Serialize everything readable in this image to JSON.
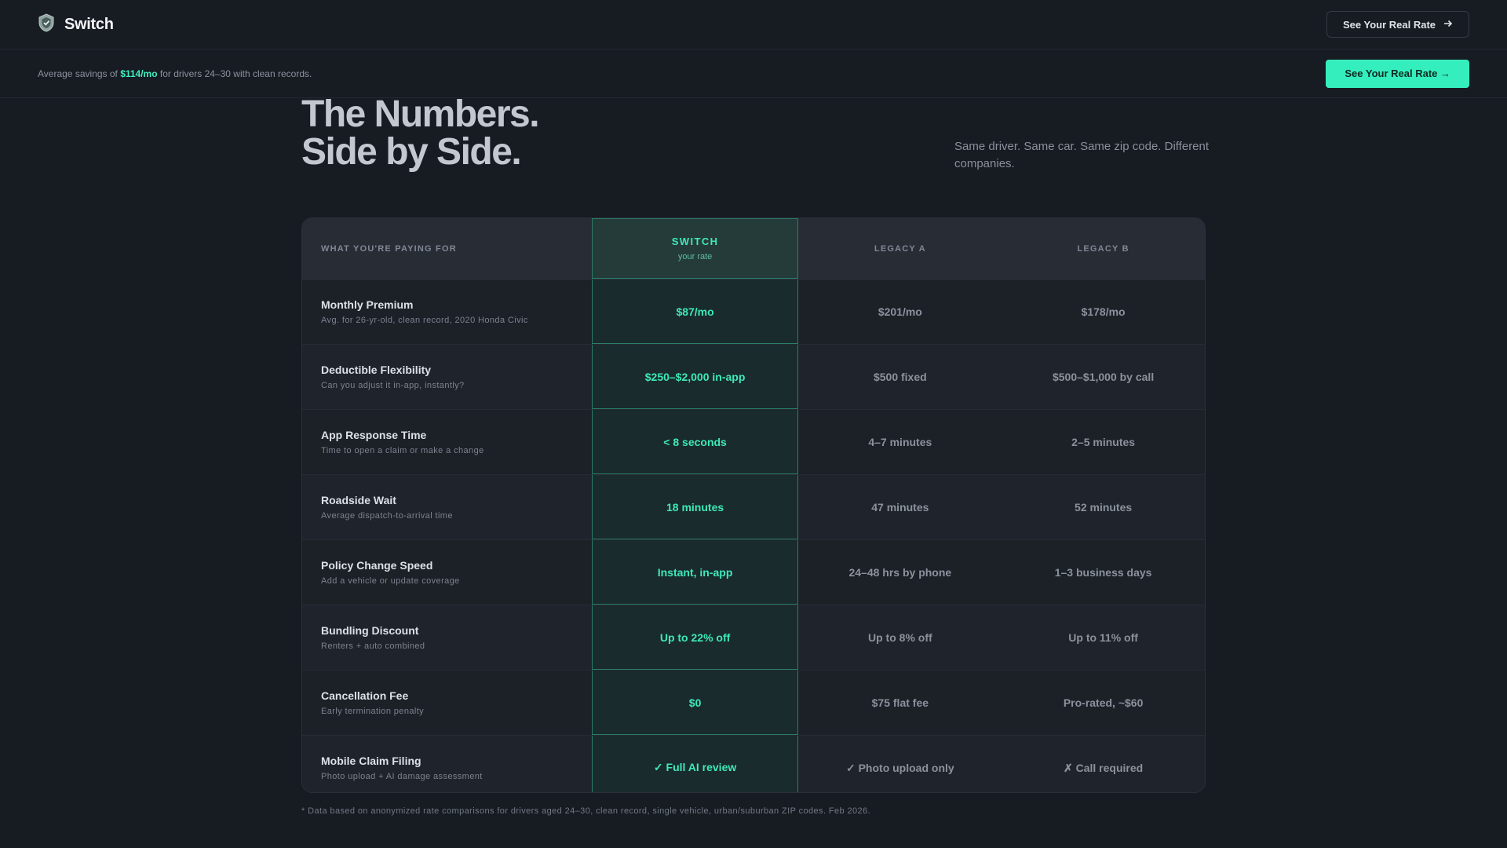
{
  "nav": {
    "brand": "Switch",
    "cta_label": "See Your Real Rate",
    "logo_icon": "shield-icon",
    "cta_icon": "arrow-right-icon"
  },
  "promo": {
    "text_before": "Average savings of ",
    "highlight": "$114/mo",
    "text_after": " for drivers 24–30 with clean records.",
    "cta_label": "See Your Real Rate →"
  },
  "hero": {
    "title_line1": "The Numbers.",
    "title_line2": "Side by Side.",
    "subtitle": "Same driver. Same car. Same zip code. Different companies."
  },
  "table": {
    "header": {
      "label": "WHAT YOU'RE PAYING FOR",
      "switch_name": "SWITCH",
      "switch_sub": "your rate",
      "legacy_a": "LEGACY A",
      "legacy_b": "LEGACY B"
    },
    "rows": [
      {
        "title": "Monthly Premium",
        "desc": "Avg. for 26-yr-old, clean record, 2020 Honda Civic",
        "switch": "$87/mo",
        "a": "$201/mo",
        "b": "$178/mo"
      },
      {
        "title": "Deductible Flexibility",
        "desc": "Can you adjust it in-app, instantly?",
        "switch": "$250–$2,000 in-app",
        "a": "$500 fixed",
        "b": "$500–$1,000 by call"
      },
      {
        "title": "App Response Time",
        "desc": "Time to open a claim or make a change",
        "switch": "< 8 seconds",
        "a": "4–7 minutes",
        "b": "2–5 minutes"
      },
      {
        "title": "Roadside Wait",
        "desc": "Average dispatch-to-arrival time",
        "switch": "18 minutes",
        "a": "47 minutes",
        "b": "52 minutes"
      },
      {
        "title": "Policy Change Speed",
        "desc": "Add a vehicle or update coverage",
        "switch": "Instant, in-app",
        "a": "24–48 hrs by phone",
        "b": "1–3 business days"
      },
      {
        "title": "Bundling Discount",
        "desc": "Renters + auto combined",
        "switch": "Up to 22% off",
        "a": "Up to 8% off",
        "b": "Up to 11% off"
      },
      {
        "title": "Cancellation Fee",
        "desc": "Early termination penalty",
        "switch": "$0",
        "a": "$75 flat fee",
        "b": "Pro-rated, ~$60"
      },
      {
        "title": "Mobile Claim Filing",
        "desc": "Photo upload + AI damage assessment",
        "switch": "✓ Full AI review",
        "a": "✓ Photo upload only",
        "b": "✗ Call required"
      }
    ]
  },
  "footnote": "* Data based on anonymized rate comparisons for drivers aged 24–30, clean record, single vehicle, urban/suburban ZIP codes. Feb 2026.",
  "colors": {
    "accent": "#35eebd",
    "background": "#171b22",
    "switch_column_border": "#2a7f66"
  }
}
